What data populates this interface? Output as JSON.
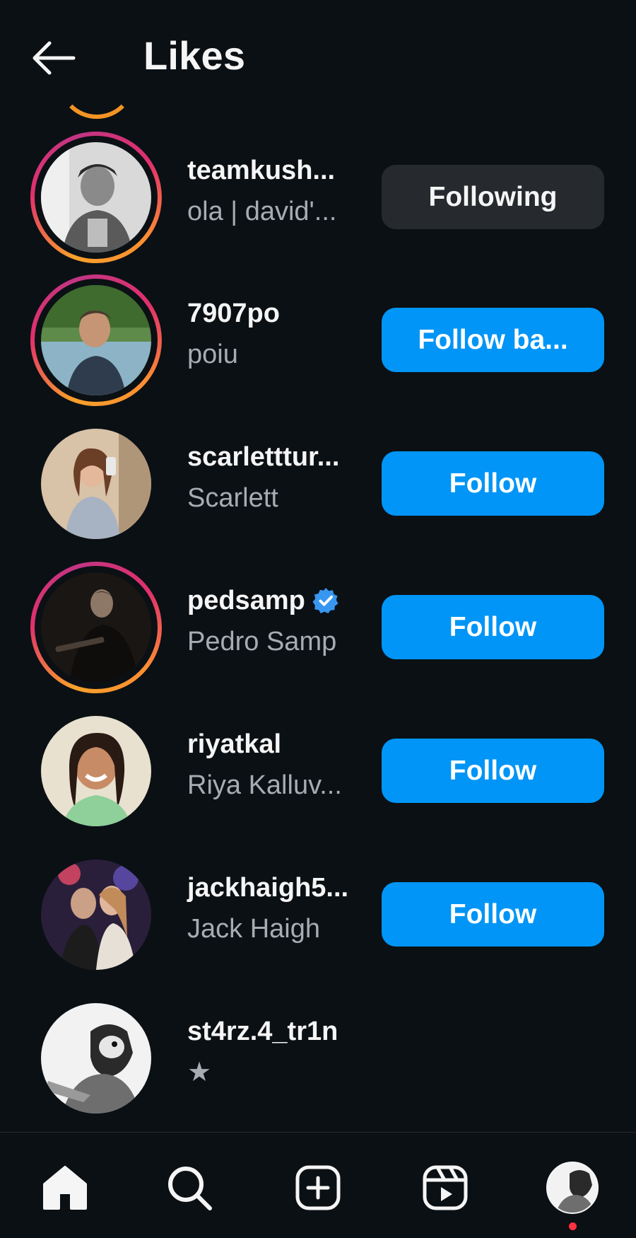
{
  "header": {
    "title": "Likes",
    "back_icon": "arrow-left-icon"
  },
  "users": [
    {
      "username": "teamkush...",
      "full_name": "ola | david'...",
      "action": "Following",
      "action_style": "secondary",
      "has_story_ring": true,
      "verified": false
    },
    {
      "username": "7907po",
      "full_name": "poiu",
      "action": "Follow ba...",
      "action_style": "primary",
      "has_story_ring": true,
      "verified": false
    },
    {
      "username": "scarletttur...",
      "full_name": "Scarlett",
      "action": "Follow",
      "action_style": "primary",
      "has_story_ring": false,
      "verified": false
    },
    {
      "username": "pedsamp",
      "full_name": "Pedro Samp",
      "action": "Follow",
      "action_style": "primary",
      "has_story_ring": true,
      "verified": true
    },
    {
      "username": "riyatkal",
      "full_name": "Riya Kalluv...",
      "action": "Follow",
      "action_style": "primary",
      "has_story_ring": false,
      "verified": false
    },
    {
      "username": "jackhaigh5...",
      "full_name": "Jack Haigh",
      "action": "Follow",
      "action_style": "primary",
      "has_story_ring": false,
      "verified": false
    },
    {
      "username": "st4rz.4_tr1n",
      "full_name": "★",
      "action": "",
      "action_style": "none",
      "has_story_ring": false,
      "verified": false
    }
  ],
  "bottom_nav": {
    "items": [
      "home-icon",
      "search-icon",
      "create-icon",
      "reels-icon",
      "profile-avatar"
    ],
    "notification_color": "#ff3040"
  },
  "colors": {
    "background": "#0b1014",
    "primary_button": "#0095f6",
    "secondary_button": "#262a2e",
    "secondary_text": "#a8acb2"
  }
}
